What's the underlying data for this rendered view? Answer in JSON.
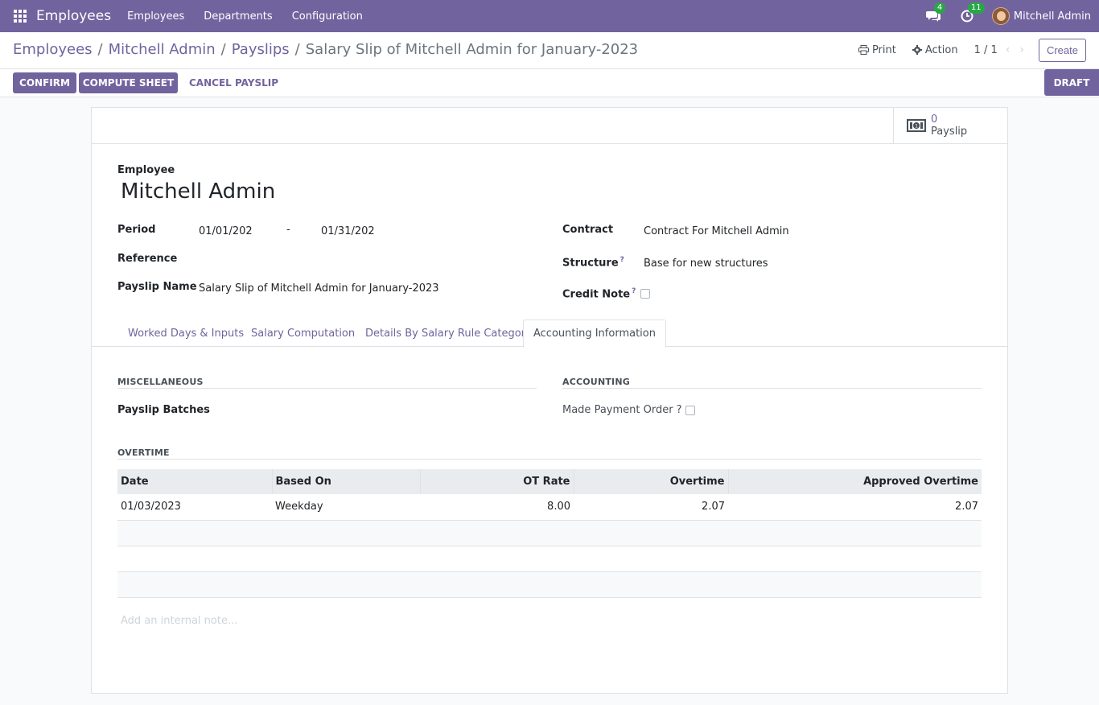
{
  "navbar": {
    "app_name": "Employees",
    "menus": [
      "Employees",
      "Departments",
      "Configuration"
    ],
    "messages_count": "4",
    "activities_count": "11",
    "user_name": "Mitchell Admin"
  },
  "breadcrumb": {
    "items": [
      "Employees",
      "Mitchell Admin",
      "Payslips"
    ],
    "current": "Salary Slip of Mitchell Admin for January-2023"
  },
  "control_panel": {
    "print_label": "Print",
    "action_label": "Action",
    "pager": "1 / 1",
    "create_label": "Create"
  },
  "statusbar": {
    "confirm_label": "CONFIRM",
    "compute_label": "COMPUTE SHEET",
    "cancel_label": "CANCEL PAYSLIP",
    "state": "DRAFT"
  },
  "smart_button": {
    "value": "0",
    "label": "Payslip"
  },
  "form": {
    "employee_label": "Employee",
    "employee_name": "Mitchell Admin",
    "period_label": "Period",
    "date_from": "01/01/202",
    "date_sep": "-",
    "date_to": "01/31/202",
    "reference_label": "Reference",
    "payslip_name_label": "Payslip Name",
    "payslip_name": "Salary Slip of Mitchell Admin for January-2023",
    "contract_label": "Contract",
    "contract_value": "Contract For Mitchell Admin",
    "structure_label": "Structure",
    "structure_value": "Base for new structures",
    "credit_note_label": "Credit Note",
    "help_mark": "?"
  },
  "tabs": [
    "Worked Days & Inputs",
    "Salary Computation",
    "Details By Salary Rule Category",
    "Accounting Information"
  ],
  "accounting_tab": {
    "misc_title": "MISCELLANEOUS",
    "batches_label": "Payslip Batches",
    "accounting_title": "ACCOUNTING",
    "payment_order_label": "Made Payment Order ?",
    "overtime_title": "OVERTIME",
    "columns": [
      "Date",
      "Based On",
      "OT Rate",
      "Overtime",
      "Approved Overtime"
    ],
    "rows": [
      {
        "date": "01/03/2023",
        "based_on": "Weekday",
        "ot_rate": "8.00",
        "overtime": "2.07",
        "approved": "2.07"
      }
    ],
    "note_placeholder": "Add an internal note..."
  }
}
